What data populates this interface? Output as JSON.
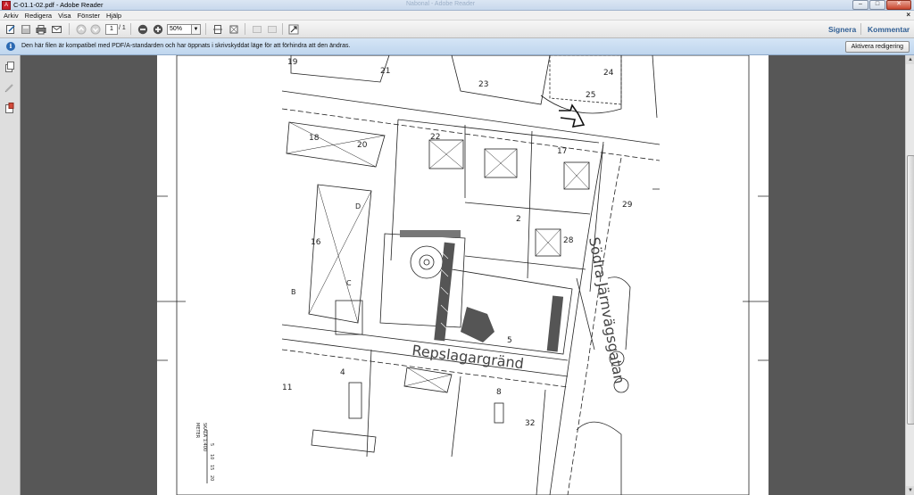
{
  "window": {
    "title": "C-01.1-02.pdf - Adobe Reader",
    "app_icon_text": "A",
    "faint_title": "Nabonal - Adobe Reader"
  },
  "menu": {
    "items": [
      "Arkiv",
      "Redigera",
      "Visa",
      "Fönster",
      "Hjälp"
    ],
    "doc_close": "×"
  },
  "toolbar": {
    "page_current": "1",
    "page_total": "/ 1",
    "zoom": "50%",
    "sign_label": "Signera",
    "comment_label": "Kommentar"
  },
  "infobar": {
    "message": "Den här filen är kompatibel med PDF/A-standarden och har öppnats i skrivskyddat läge för att förhindra att den ändras.",
    "button_label": "Aktivera redigering"
  },
  "drawing": {
    "street_1": "Repslagargränd",
    "street_2": "Södra Järnvägsgatan",
    "lot_numbers": [
      "19",
      "21",
      "23",
      "24",
      "25",
      "18",
      "20",
      "22",
      "17",
      "16",
      "2",
      "28",
      "29",
      "4",
      "5",
      "8",
      "32",
      "11",
      "C",
      "D",
      "B"
    ],
    "scale_label": "SKALA 1:400",
    "scale_unit": "METER",
    "scale_ticks": [
      "5",
      "10",
      "15",
      "20"
    ]
  },
  "colors": {
    "accent": "#2f5e94",
    "info_bg": "#cfe1f4"
  }
}
